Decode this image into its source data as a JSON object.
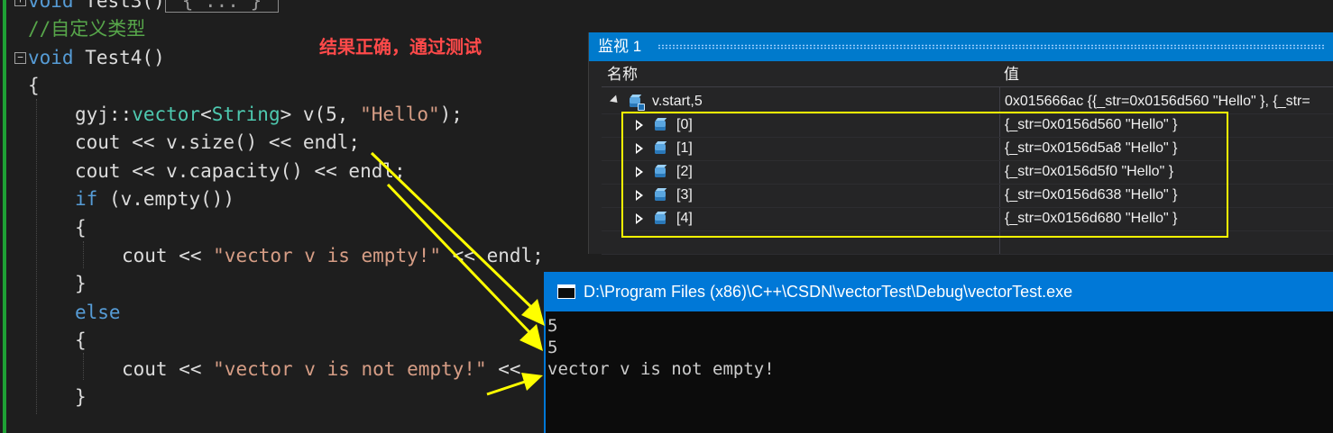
{
  "editor": {
    "lines": {
      "l0": {
        "kw": "void",
        "rest": " Test3()",
        "collapsed": "{ ... }"
      },
      "l1": {
        "comment": "//自定义类型"
      },
      "l2": {
        "kw": "void",
        "rest": " Test4()"
      },
      "l3": {
        "text": "{"
      },
      "l4": {
        "p1": "gyj::",
        "p2": "vector",
        "p3": "<",
        "p4": "String",
        "p5": "> v(5, ",
        "p6": "\"Hello\"",
        "p7": ");"
      },
      "l5": {
        "text": "cout << v.size() << endl;"
      },
      "l6": {
        "text": "cout << v.capacity() << endl;"
      },
      "l7": {
        "kw": "if",
        "rest": " (v.empty())"
      },
      "l8": {
        "text": "{"
      },
      "l9": {
        "p1": "cout << ",
        "p2": "\"vector v is empty!\"",
        "p3": " << endl;"
      },
      "l10": {
        "text": "}"
      },
      "l11": {
        "kw": "else"
      },
      "l12": {
        "text": "{"
      },
      "l13": {
        "p1": "cout << ",
        "p2": "\"vector v is not empty!\"",
        "p3": " <<"
      },
      "l14": {
        "text": "}"
      }
    }
  },
  "annotation": {
    "text": "结果正确，通过测试",
    "color": "#ff4a4a"
  },
  "watch": {
    "title": "监视 1",
    "columns": {
      "name": "名称",
      "value": "值"
    },
    "root": {
      "name": "v.start,5",
      "value": "0x015666ac {{_str=0x0156d560 \"Hello\" }, {_str="
    },
    "rows": [
      {
        "name": "[0]",
        "value": "{_str=0x0156d560 \"Hello\" }"
      },
      {
        "name": "[1]",
        "value": "{_str=0x0156d5a8 \"Hello\" }"
      },
      {
        "name": "[2]",
        "value": "{_str=0x0156d5f0 \"Hello\" }"
      },
      {
        "name": "[3]",
        "value": "{_str=0x0156d638 \"Hello\" }"
      },
      {
        "name": "[4]",
        "value": "{_str=0x0156d680 \"Hello\" }"
      }
    ]
  },
  "console": {
    "title": "D:\\Program Files (x86)\\C++\\CSDN\\vectorTest\\Debug\\vectorTest.exe",
    "output": [
      "5",
      "5",
      "vector v is not empty!"
    ]
  },
  "colors": {
    "accent": "#007acc",
    "highlight": "#ffff00",
    "arrow": "#ffff00"
  }
}
